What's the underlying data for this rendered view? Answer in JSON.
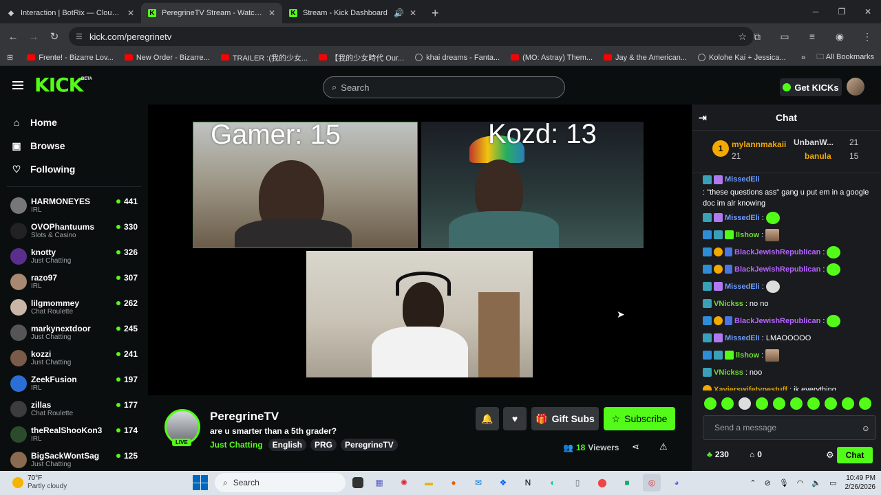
{
  "browser": {
    "tabs": [
      {
        "title": "Interaction | BotRix — Cloud St",
        "icon": "botrix-icon",
        "active": false
      },
      {
        "title": "PeregrineTV Stream - Watch Li",
        "icon": "kick-icon",
        "active": true
      },
      {
        "title": "Stream - Kick Dashboard",
        "icon": "kick-icon",
        "active": false,
        "audio": true
      }
    ],
    "url": "kick.com/peregrinetv",
    "bookmarks": [
      {
        "label": "Frente! - Bizarre Lov...",
        "icon": "youtube-icon"
      },
      {
        "label": "New Order - Bizarre...",
        "icon": "youtube-icon"
      },
      {
        "label": "TRAILER :(我的少女...",
        "icon": "youtube-icon"
      },
      {
        "label": "【我的少女時代 Our...",
        "icon": "youtube-icon"
      },
      {
        "label": "khai dreams - Fanta...",
        "icon": "globe-icon"
      },
      {
        "label": "(MO: Astray) Them...",
        "icon": "youtube-icon"
      },
      {
        "label": "Jay & the American...",
        "icon": "youtube-icon"
      },
      {
        "label": "Kolohe Kai + Jessica...",
        "icon": "globe-icon"
      }
    ],
    "all_bookmarks": "All Bookmarks"
  },
  "kick": {
    "logo": "KICK",
    "beta": "BETA",
    "search_placeholder": "Search",
    "get_kicks": "Get KICKs",
    "nav": [
      {
        "label": "Home",
        "icon": "home-icon"
      },
      {
        "label": "Browse",
        "icon": "browse-icon"
      },
      {
        "label": "Following",
        "icon": "heart-icon"
      }
    ],
    "channels": [
      {
        "name": "HARMONEYES",
        "category": "IRL",
        "viewers": "441",
        "color": "#777"
      },
      {
        "name": "OVOPhantuums",
        "category": "Slots & Casino",
        "viewers": "330",
        "color": "#222"
      },
      {
        "name": "knotty",
        "category": "Just Chatting",
        "viewers": "326",
        "color": "#5b2d8c"
      },
      {
        "name": "razo97",
        "category": "IRL",
        "viewers": "307",
        "color": "#a88870"
      },
      {
        "name": "lilgmommey",
        "category": "Chat Roulette",
        "viewers": "262",
        "color": "#c9b6a6"
      },
      {
        "name": "markynextdoor",
        "category": "Just Chatting",
        "viewers": "245",
        "color": "#555"
      },
      {
        "name": "kozzi",
        "category": "Just Chatting",
        "viewers": "241",
        "color": "#7a5a48"
      },
      {
        "name": "ZeekFusion",
        "category": "IRL",
        "viewers": "197",
        "color": "#2a6fd6"
      },
      {
        "name": "zillas",
        "category": "Chat Roulette",
        "viewers": "177",
        "color": "#3c3c3c"
      },
      {
        "name": "theRealShooKon3",
        "category": "IRL",
        "viewers": "174",
        "color": "#2c4a2c"
      },
      {
        "name": "BigSackWontSag",
        "category": "Just Chatting",
        "viewers": "125",
        "color": "#8a6a50"
      }
    ]
  },
  "video": {
    "score1": "Gamer: 15",
    "score2": "Kozd: 13"
  },
  "stream": {
    "name": "PeregrineTV",
    "live": "LIVE",
    "title": "are u smarter than a 5th grader?",
    "category": "Just Chatting",
    "tags": [
      "English",
      "PRG",
      "PeregrineTV"
    ],
    "gift_subs": "Gift Subs",
    "subscribe": "Subscribe",
    "viewers_count": "18",
    "viewers_label": "Viewers"
  },
  "chat": {
    "title": "Chat",
    "leaderboard": [
      {
        "name": "mylannmakaii",
        "count": "21"
      },
      {
        "name": "UnbanW...",
        "count": "21"
      },
      {
        "name": "banula",
        "count": "15"
      }
    ],
    "messages": [
      {
        "user": "MissedEli",
        "text": ": \"these questions ass\" gang u put em in a google doc im alr knowing",
        "ucls": "u1",
        "badges": [
          "b-sub",
          "b-gift"
        ]
      },
      {
        "user": "MissedEli",
        "text": ":",
        "ucls": "u1",
        "badges": [
          "b-sub",
          "b-gift"
        ],
        "emote": "emote"
      },
      {
        "user": "llshow",
        "text": ":",
        "ucls": "u3",
        "badges": [
          "b-blue",
          "b-sub",
          "b-green"
        ],
        "emote": "face"
      },
      {
        "user": "BlackJewishRepublican",
        "text": ":",
        "ucls": "u2",
        "badges": [
          "b-blue",
          "b-gold",
          "b-v"
        ],
        "emote": "emote"
      },
      {
        "user": "BlackJewishRepublican",
        "text": ":",
        "ucls": "u2",
        "badges": [
          "b-blue",
          "b-gold",
          "b-v"
        ],
        "emote": "emote"
      },
      {
        "user": "MissedEli",
        "text": ":",
        "ucls": "u1",
        "badges": [
          "b-sub",
          "b-gift"
        ],
        "emote": "skull"
      },
      {
        "user": "VNickss",
        "text": ": no no",
        "ucls": "u3",
        "badges": [
          "b-sub"
        ]
      },
      {
        "user": "BlackJewishRepublican",
        "text": ":",
        "ucls": "u2",
        "badges": [
          "b-blue",
          "b-gold",
          "b-v"
        ],
        "emote": "emote"
      },
      {
        "user": "MissedEli",
        "text": ": LMAOOOOO",
        "ucls": "u1",
        "badges": [
          "b-sub",
          "b-gift"
        ]
      },
      {
        "user": "llshow",
        "text": ":",
        "ucls": "u3",
        "badges": [
          "b-blue",
          "b-sub",
          "b-green"
        ],
        "emote": "face"
      },
      {
        "user": "VNickss",
        "text": ": noo",
        "ucls": "u3",
        "badges": [
          "b-sub"
        ]
      },
      {
        "user": "Xavierswifetypestuff",
        "text": ": ik everything.",
        "ucls": "u4",
        "badges": [
          "b-gold"
        ]
      }
    ],
    "input_placeholder": "Send a message",
    "points": "230",
    "redeems": "0",
    "chat_button": "Chat"
  },
  "taskbar": {
    "temp": "70°F",
    "weather": "Partly cloudy",
    "search": "Search",
    "time": "10:49 PM",
    "date": "2/26/2026"
  }
}
